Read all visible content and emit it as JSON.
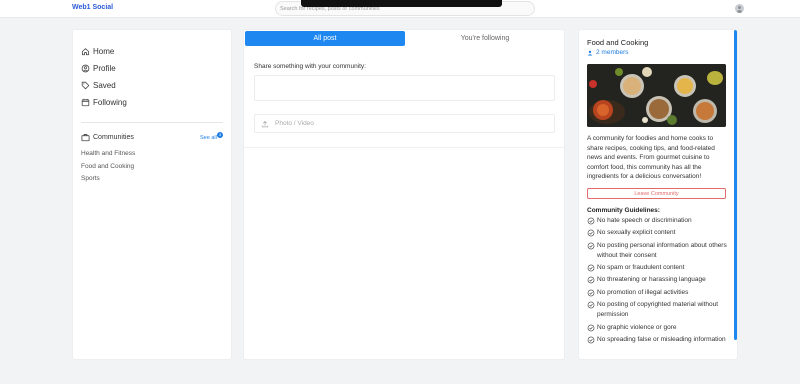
{
  "app": {
    "brand": "Web1 Social"
  },
  "search": {
    "placeholder": "Search for recipes, posts or communities"
  },
  "nav": {
    "items": [
      {
        "label": "Home",
        "icon": "home-icon"
      },
      {
        "label": "Profile",
        "icon": "profile-icon"
      },
      {
        "label": "Saved",
        "icon": "tag-icon"
      },
      {
        "label": "Following",
        "icon": "calendar-icon"
      }
    ],
    "communities_label": "Communities",
    "see_all": "See all",
    "see_all_count": "3",
    "communities": [
      "Health and Fitness",
      "Food and Cooking",
      "Sports"
    ]
  },
  "feed": {
    "tabs": [
      {
        "label": "All post",
        "active": true
      },
      {
        "label": "You're following",
        "active": false
      }
    ],
    "share_label": "Share something with your community:",
    "photo_video_label": "Photo / Video"
  },
  "community": {
    "name": "Food and Cooking",
    "members": "2 members",
    "description": "A community for foodies and home cooks to share recipes, cooking tips, and food-related news and events. From gourmet cuisine to comfort food, this community has all the ingredients for a delicious conversation!",
    "leave_label": "Leave Community",
    "guidelines_title": "Community Guidelines:",
    "guidelines": [
      "No hate speech or discrimination",
      "No sexually explicit content",
      "No posting personal information about others without their consent",
      "No spam or fraudulent content",
      "No threatening or harassing language",
      "No promotion of illegal activities",
      "No posting of copyrighted material without permission",
      "No graphic violence or gore",
      "No spreading false or misleading information"
    ]
  },
  "colors": {
    "accent": "#1e87f0",
    "danger": "#e26a6a",
    "background": "#f2f3f5"
  }
}
